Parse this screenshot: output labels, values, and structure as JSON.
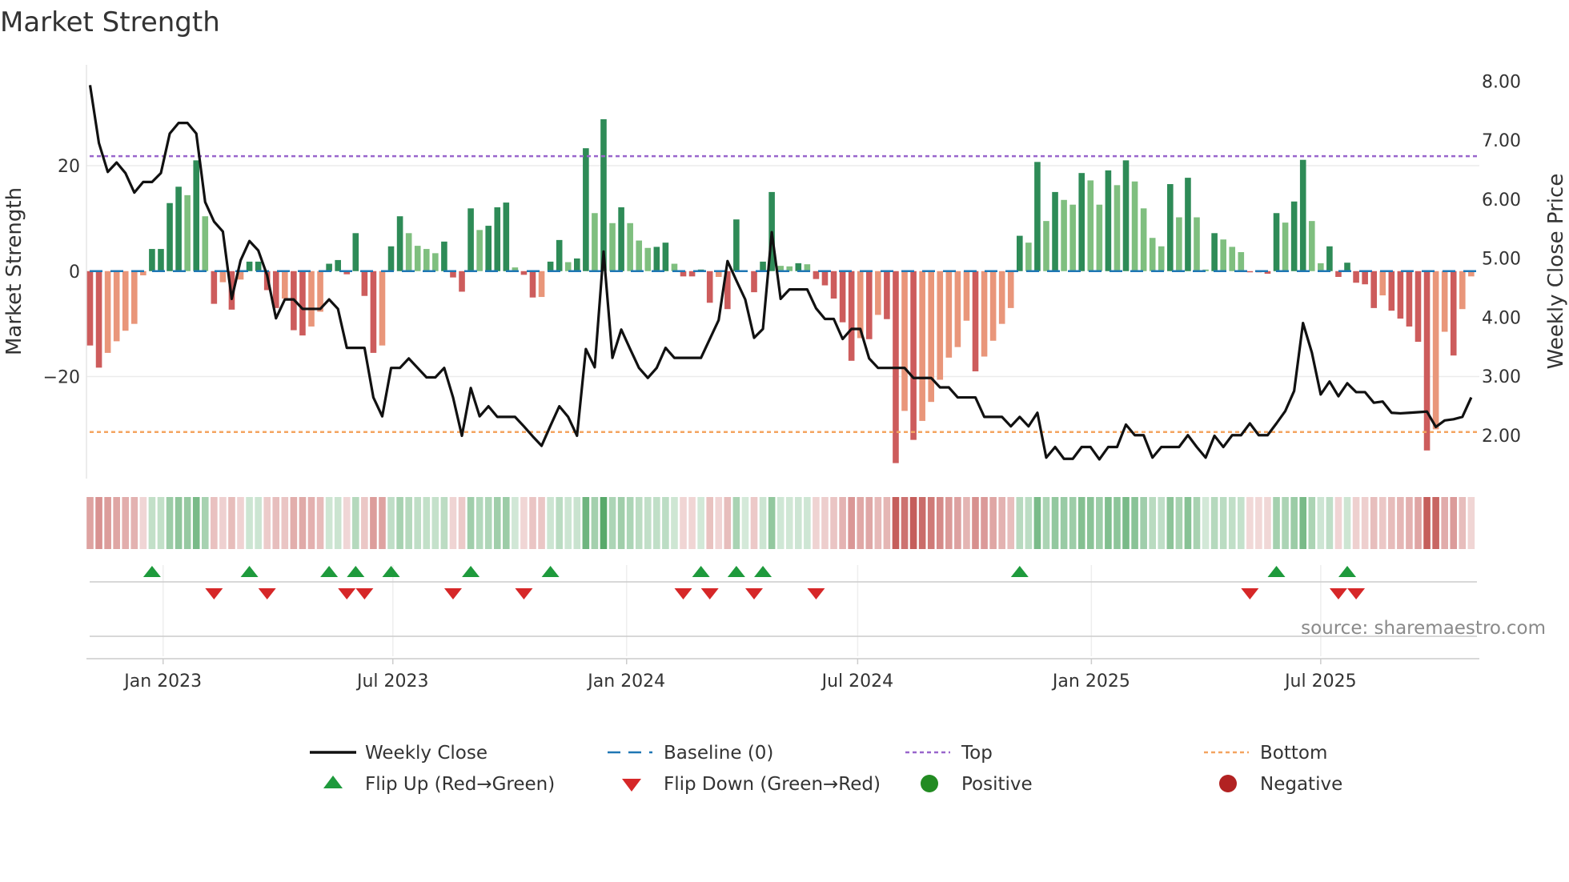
{
  "chart_data": {
    "type": "bar",
    "title": "Market Strength",
    "ylabel": "Market Strength",
    "y2label": "Weekly Close Price",
    "source": "source: sharemaestro.com",
    "ylim": [
      -39,
      34.5
    ],
    "y2lim": [
      1.3,
      8.3
    ],
    "yticks": [
      {
        "v": 20,
        "label": "20"
      },
      {
        "v": 0,
        "label": "0"
      },
      {
        "v": -20,
        "label": "−20"
      }
    ],
    "y2ticks": [
      {
        "v": 8,
        "label": "8.00"
      },
      {
        "v": 7,
        "label": "7.00"
      },
      {
        "v": 6,
        "label": "6.00"
      },
      {
        "v": 5,
        "label": "5.00"
      },
      {
        "v": 4,
        "label": "4.00"
      },
      {
        "v": 3,
        "label": "3.00"
      },
      {
        "v": 2,
        "label": "2.00"
      }
    ],
    "xticks": [
      {
        "week": 8.25,
        "label": "Jan 2023"
      },
      {
        "week": 34.2,
        "label": "Jul 2023"
      },
      {
        "week": 60.6,
        "label": "Jan 2024"
      },
      {
        "week": 86.7,
        "label": "Jul 2024"
      },
      {
        "week": 113.1,
        "label": "Jan 2025"
      },
      {
        "week": 139,
        "label": "Jul 2025"
      }
    ],
    "top_level": 21.8,
    "bottom_level": -30.5,
    "baseline": 0,
    "strength": [
      -14.1,
      -18.3,
      -15.5,
      -13.3,
      -11.3,
      -10,
      -0.8,
      4.2,
      4.2,
      12.9,
      16,
      14.4,
      21,
      10.4,
      -6.2,
      -2.1,
      -7.3,
      -1.6,
      1.8,
      1.8,
      -3.6,
      -7,
      -5.2,
      -11.2,
      -12.2,
      -10.5,
      -7.7,
      1.4,
      2.1,
      -0.6,
      7.2,
      -4.7,
      -15.5,
      -14.1,
      4.7,
      10.4,
      7.2,
      4.8,
      4.2,
      3.4,
      5.6,
      -1.2,
      -3.9,
      11.9,
      7.8,
      8.6,
      12.1,
      13,
      0.7,
      -0.7,
      -5,
      -4.9,
      1.8,
      5.9,
      1.7,
      2.4,
      23.3,
      11,
      28.8,
      9.1,
      12.1,
      9.1,
      5.8,
      4.4,
      4.6,
      5.4,
      1.4,
      -1,
      -1,
      0.3,
      -6,
      -1.1,
      -7.2,
      9.8,
      0,
      -4,
      1.8,
      15,
      1,
      0.9,
      1.5,
      1.3,
      -1.5,
      -2.7,
      -5.2,
      -9.7,
      -17,
      -12.7,
      -12.9,
      -8.3,
      -9.1,
      -36.4,
      -26.5,
      -32,
      -28.4,
      -24.8,
      -20.6,
      -16.4,
      -14.4,
      -9.4,
      -19,
      -16.2,
      -13.2,
      -10,
      -7,
      6.7,
      5.4,
      20.7,
      9.5,
      15,
      13.5,
      12.6,
      18.6,
      17.2,
      12.6,
      19.1,
      16.3,
      21,
      17,
      11.9,
      6.3,
      4.7,
      16.5,
      10.2,
      17.7,
      10.2,
      0.3,
      7.2,
      6,
      4.6,
      3.6,
      -0.1,
      -0.2,
      -0.5,
      11,
      9.2,
      13.2,
      21.1,
      9.5,
      1.5,
      4.7,
      -1.1,
      1.6,
      -2.2,
      -2.5,
      -7,
      -4.6,
      -7.5,
      -9,
      -10.5,
      -13.4,
      -34,
      -30,
      -11.5,
      -16,
      -7.2,
      -1
    ],
    "weekly_close": [
      7.93,
      6.95,
      6.46,
      6.62,
      6.44,
      6.11,
      6.29,
      6.29,
      6.44,
      7.11,
      7.29,
      7.29,
      7.11,
      5.95,
      5.62,
      5.45,
      4.31,
      4.96,
      5.29,
      5.13,
      4.71,
      3.98,
      4.3,
      4.3,
      4.14,
      4.14,
      4.14,
      4.3,
      4.14,
      3.48,
      3.48,
      3.48,
      2.64,
      2.32,
      3.14,
      3.14,
      3.3,
      3.14,
      2.98,
      2.98,
      3.14,
      2.64,
      1.99,
      2.8,
      2.32,
      2.49,
      2.31,
      2.31,
      2.31,
      2.15,
      1.98,
      1.82,
      2.16,
      2.49,
      2.31,
      1.99,
      3.46,
      3.15,
      5.11,
      3.31,
      3.79,
      3.46,
      3.14,
      2.97,
      3.14,
      3.48,
      3.31,
      3.31,
      3.31,
      3.31,
      3.63,
      3.95,
      4.95,
      4.62,
      4.3,
      3.65,
      3.8,
      5.44,
      4.31,
      4.47,
      4.47,
      4.47,
      4.15,
      3.97,
      3.97,
      3.63,
      3.8,
      3.8,
      3.3,
      3.14,
      3.14,
      3.14,
      3.14,
      2.97,
      2.97,
      2.97,
      2.81,
      2.81,
      2.64,
      2.64,
      2.64,
      2.31,
      2.31,
      2.31,
      2.15,
      2.31,
      2.15,
      2.38,
      1.62,
      1.8,
      1.6,
      1.6,
      1.8,
      1.8,
      1.59,
      1.8,
      1.8,
      2.18,
      2.0,
      2.0,
      1.62,
      1.8,
      1.8,
      1.8,
      2.0,
      1.8,
      1.62,
      1.99,
      1.8,
      2.0,
      2.0,
      2.2,
      2.0,
      2.0,
      2.2,
      2.41,
      2.75,
      3.9,
      3.4,
      2.69,
      2.91,
      2.66,
      2.88,
      2.73,
      2.73,
      2.55,
      2.57,
      2.38,
      2.37,
      2.38,
      2.39,
      2.4,
      2.14,
      2.25,
      2.27,
      2.31,
      2.64
    ],
    "flip_up_weeks": [
      7,
      18,
      27,
      30,
      34,
      43,
      52,
      69,
      73,
      76,
      105,
      134,
      142
    ],
    "flip_down_weeks": [
      14,
      20,
      29,
      31,
      41,
      49,
      67,
      70,
      75,
      82,
      131,
      141,
      143
    ],
    "legend": {
      "placement": "bottom",
      "items": [
        {
          "label": "Weekly Close"
        },
        {
          "label": "Baseline (0)"
        },
        {
          "label": "Top"
        },
        {
          "label": "Bottom"
        },
        {
          "label": "Flip Up (Red→Green)"
        },
        {
          "label": "Flip Down (Green→Red)"
        },
        {
          "label": "Positive"
        },
        {
          "label": "Negative"
        }
      ]
    },
    "colors": {
      "pos_strong": "#2e8b57",
      "pos_weak": "#7fbf7f",
      "neg_strong": "#cd5c5c",
      "neg_weak": "#e9967a",
      "close": "#111111",
      "baseline": "#1f77b4",
      "top": "#9966cc",
      "bottom": "#f4a460",
      "flip_up": "#1e9a3c",
      "flip_down": "#d62728",
      "positive": "#228b22",
      "negative": "#b22222"
    }
  }
}
